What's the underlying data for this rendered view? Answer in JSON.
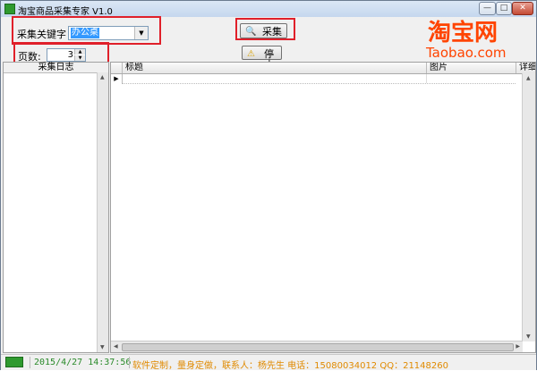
{
  "window": {
    "title": "淘宝商品采集专家 V1.0",
    "min_glyph": "—",
    "max_glyph": "□",
    "close_glyph": "✕"
  },
  "search": {
    "keyword_label": "采集关键字",
    "keyword_value": "办公桌",
    "pages_label": "页数:",
    "pages_value": "3"
  },
  "actions": {
    "collect_label": "采集",
    "stop_label": "停止"
  },
  "logo": {
    "line1": "淘宝网",
    "line2": "Taobao.com"
  },
  "log": {
    "header": "采集日志"
  },
  "table": {
    "columns": [
      "标题",
      "图片",
      "详细"
    ],
    "row_marker": "▶"
  },
  "status": {
    "datetime": "2015/4/27 14:37:56",
    "contact": "软件定制，量身定做，联系人：杨先生 电话：15080034012 QQ：21148260"
  },
  "colors": {
    "highlight": "#e0202a",
    "brand": "#ff4400",
    "status_time": "#2a8a2a",
    "status_contact": "#e08a00"
  }
}
